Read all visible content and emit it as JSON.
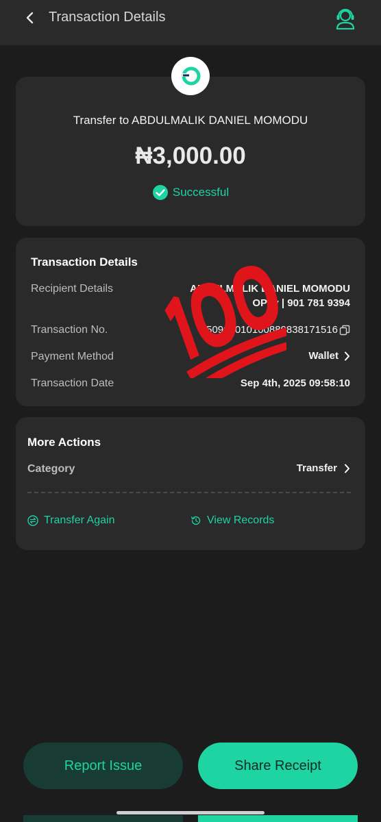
{
  "header": {
    "title": "Transaction Details",
    "back_icon": "chevron-left-icon",
    "support_icon": "customer-support-icon"
  },
  "summary": {
    "transfer_to": "Transfer to ABDULMALIK DANIEL MOMODU",
    "amount": "₦3,000.00",
    "status": "Successful",
    "status_color": "#1ed4a2"
  },
  "details": {
    "title": "Transaction Details",
    "rows": [
      {
        "label": "Recipient Details",
        "value": "ABDULMALIK DANIEL MOMODU",
        "sub": "OPay | 901 781 9394"
      },
      {
        "label": "Transaction No.",
        "value": "250904010100889838171516"
      },
      {
        "label": "Payment Method",
        "value": "Wallet"
      },
      {
        "label": "Transaction Date",
        "value": "Sep 4th, 2025 09:58:10"
      }
    ]
  },
  "actions": {
    "title": "More Actions",
    "category_label": "Category",
    "category_value": "Transfer",
    "transfer_again": "Transfer Again",
    "view_records": "View Records"
  },
  "footer": {
    "report_issue": "Report Issue",
    "share_receipt": "Share Receipt"
  },
  "colors": {
    "accent": "#1ed4a2",
    "background": "#1c1c1c",
    "card": "#2a2a2a",
    "stamp": "#e0141b"
  }
}
